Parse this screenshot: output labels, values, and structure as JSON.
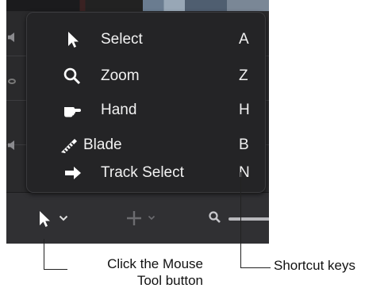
{
  "menu": {
    "items": [
      {
        "label": "Select",
        "key": "A",
        "icon": "arrow-pointer-icon"
      },
      {
        "label": "Zoom",
        "key": "Z",
        "icon": "magnifier-icon"
      },
      {
        "label": "Hand",
        "key": "H",
        "icon": "hand-icon"
      },
      {
        "label": "Blade",
        "key": "B",
        "icon": "blade-icon"
      },
      {
        "label": "Track Select",
        "key": "N",
        "icon": "track-select-arrow-icon"
      }
    ]
  },
  "toolbar": {
    "mouse_tool_icon": "arrow-pointer-icon",
    "add_icon": "plus-icon",
    "zoom_icon": "magnifier-icon"
  },
  "annotations": {
    "mouse_tool_line1": "Click the Mouse",
    "mouse_tool_line2": "Tool  button",
    "shortcut_keys": "Shortcut keys"
  },
  "colors": {
    "menu_background": "#242426",
    "menu_text": "#f2f2f2",
    "toolbar_background": "#303033"
  }
}
